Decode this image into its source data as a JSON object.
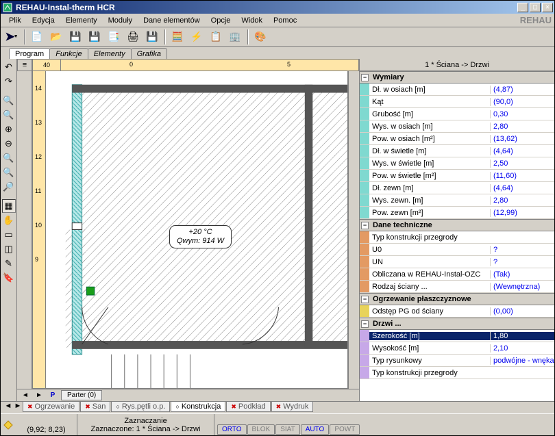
{
  "window": {
    "title": "REHAU-Instal-therm HCR",
    "brand": "REHAU"
  },
  "menu": [
    "Plik",
    "Edycja",
    "Elementy",
    "Moduły",
    "Dane elementów",
    "Opcje",
    "Widok",
    "Pomoc"
  ],
  "view_tabs": [
    "Program",
    "Funkcje",
    "Elementy",
    "Grafika"
  ],
  "ruler_corner": "40",
  "ruler_h": [
    "0",
    "5"
  ],
  "ruler_v": [
    "14",
    "13",
    "12",
    "11",
    "10",
    "9"
  ],
  "room": {
    "line1": "+20 °C",
    "line2": "Qwym: 914 W"
  },
  "level_tab": "Parter (0)",
  "props": {
    "title": "1 * Ściana -> Drzwi",
    "groups": [
      {
        "name": "Wymiary",
        "swatch": "#7fd9d0",
        "rows": [
          {
            "l": "Dł. w osiach [m]",
            "v": "(4,87)"
          },
          {
            "l": "Kąt",
            "v": "(90,0)"
          },
          {
            "l": "Grubość [m]",
            "v": "0,30"
          },
          {
            "l": "Wys. w osiach [m]",
            "v": "2,80"
          },
          {
            "l": "Pow. w osiach [m²]",
            "v": "(13,62)"
          },
          {
            "l": "Dł. w świetle [m]",
            "v": "(4,64)"
          },
          {
            "l": "Wys. w świetle [m]",
            "v": "2,50"
          },
          {
            "l": "Pow. w świetle [m²]",
            "v": "(11,60)"
          },
          {
            "l": "Dł. zewn [m]",
            "v": "(4,64)"
          },
          {
            "l": "Wys. zewn. [m]",
            "v": "2,80"
          },
          {
            "l": "Pow. zewn [m²]",
            "v": "(12,99)"
          }
        ]
      },
      {
        "name": "Dane techniczne",
        "swatch": "#e39a63",
        "rows": [
          {
            "l": "Typ konstrukcji przegrody",
            "v": ""
          },
          {
            "l": "U0",
            "v": "?"
          },
          {
            "l": "UN",
            "v": "?"
          },
          {
            "l": "Obliczana w REHAU-Instal-OZC",
            "v": "(Tak)"
          },
          {
            "l": "Rodzaj ściany ...",
            "v": "(Wewnętrzna)"
          }
        ]
      },
      {
        "name": "Ogrzewanie płaszczyznowe",
        "swatch": "#e8d35a",
        "rows": [
          {
            "l": "Odstęp PG od ściany",
            "v": "(0,00)"
          }
        ]
      },
      {
        "name": "Drzwi ...",
        "swatch": "#c7a8e8",
        "rows": [
          {
            "l": "Szerokość [m]",
            "v": "1,80",
            "sel": true
          },
          {
            "l": "Wysokość [m]",
            "v": "2,10"
          },
          {
            "l": "Typ rysunkowy",
            "v": "podwójne - wnęka"
          },
          {
            "l": "Typ konstrukcji przegrody",
            "v": ""
          }
        ]
      }
    ]
  },
  "bottom_tabs": [
    {
      "l": "Ogrzewanie",
      "c": "#e08030",
      "x": true
    },
    {
      "l": "San",
      "c": "#e08030",
      "x": true,
      "cut": true
    },
    {
      "l": "Rys.pętli o.p.",
      "c": "#999",
      "x": false
    },
    {
      "l": "Konstrukcja",
      "c": "#d8c838",
      "x": false,
      "active": true
    },
    {
      "l": "Podkład",
      "c": "#3a9c3a",
      "x": true
    },
    {
      "l": "Wydruk",
      "c": "#999",
      "x": true
    }
  ],
  "status": {
    "action": "Zaznaczanie",
    "selection": "Zaznaczone: 1 * Ściana -> Drzwi",
    "coords": "(9,92; 8,23)",
    "modes": [
      {
        "l": "ORTO",
        "on": true
      },
      {
        "l": "BLOK",
        "on": false
      },
      {
        "l": "SIAT",
        "on": false
      },
      {
        "l": "AUTO",
        "on": true
      },
      {
        "l": "POWT",
        "on": false
      }
    ]
  }
}
